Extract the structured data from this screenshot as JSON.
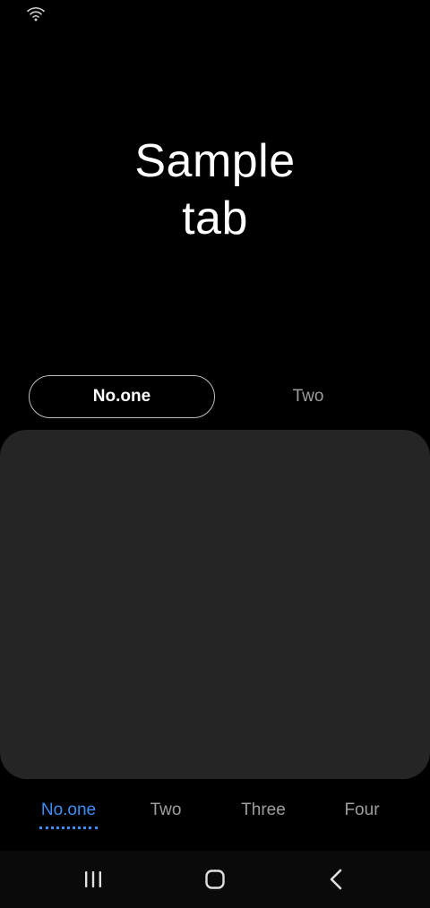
{
  "status_bar": {
    "icons": [
      "wifi-icon"
    ]
  },
  "header": {
    "title_line1": "Sample",
    "title_line2": "tab"
  },
  "segmented_tabs": [
    {
      "label": "No.one",
      "selected": true
    },
    {
      "label": "Two",
      "selected": false
    }
  ],
  "bottom_tabs": [
    {
      "label": "No.one",
      "selected": true
    },
    {
      "label": "Two",
      "selected": false
    },
    {
      "label": "Three",
      "selected": false
    },
    {
      "label": "Four",
      "selected": false
    }
  ],
  "navigation_bar": {
    "buttons": [
      "recent-apps-icon",
      "home-icon",
      "back-icon"
    ]
  },
  "colors": {
    "background": "#000000",
    "card": "#252525",
    "accent": "#3e8df6",
    "inactive_text": "#9e9e9e",
    "nav_bar": "#0a0a0a"
  }
}
